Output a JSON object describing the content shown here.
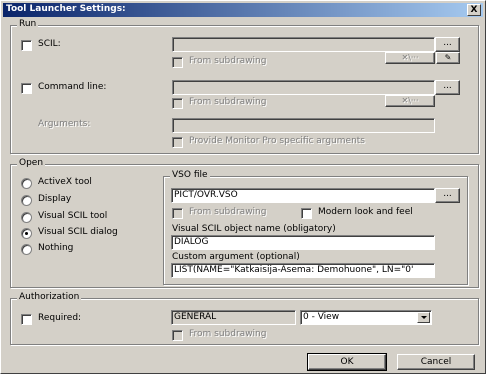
{
  "window": {
    "title": "Tool Launcher Settings:",
    "close_glyph": "X"
  },
  "run": {
    "group_label": "Run",
    "scil_label": "SCIL:",
    "from_subdrawing": "From subdrawing",
    "command_line_label": "Command line:",
    "arguments_label": "Arguments:",
    "provide_label": "Provide Monitor Pro specific arguments",
    "browse_label": "...",
    "slash_label": "✕\\···"
  },
  "open": {
    "group_label": "Open",
    "options": [
      "ActiveX tool",
      "Display",
      "Visual SCIL tool",
      "Visual SCIL dialog",
      "Nothing"
    ],
    "selected_index": 3,
    "vso_label": "VSO file",
    "vso_value": "PICT/OVR.VSO",
    "from_subdrawing": "From subdrawing",
    "modern_label": "Modern look and feel",
    "object_name_label": "Visual SCIL object name (obligatory)",
    "object_name_value": "DIALOG",
    "custom_arg_label": "Custom argument (optional)",
    "custom_arg_value": "LIST(NAME=\"Katkaisija-Asema: Demohuone\", LN=\"0'",
    "browse_label": "..."
  },
  "authorization": {
    "group_label": "Authorization",
    "required_label": "Required:",
    "group_value": "GENERAL",
    "level_value": "0 - View",
    "from_subdrawing": "From subdrawing"
  },
  "buttons": {
    "ok": "OK",
    "cancel": "Cancel"
  }
}
